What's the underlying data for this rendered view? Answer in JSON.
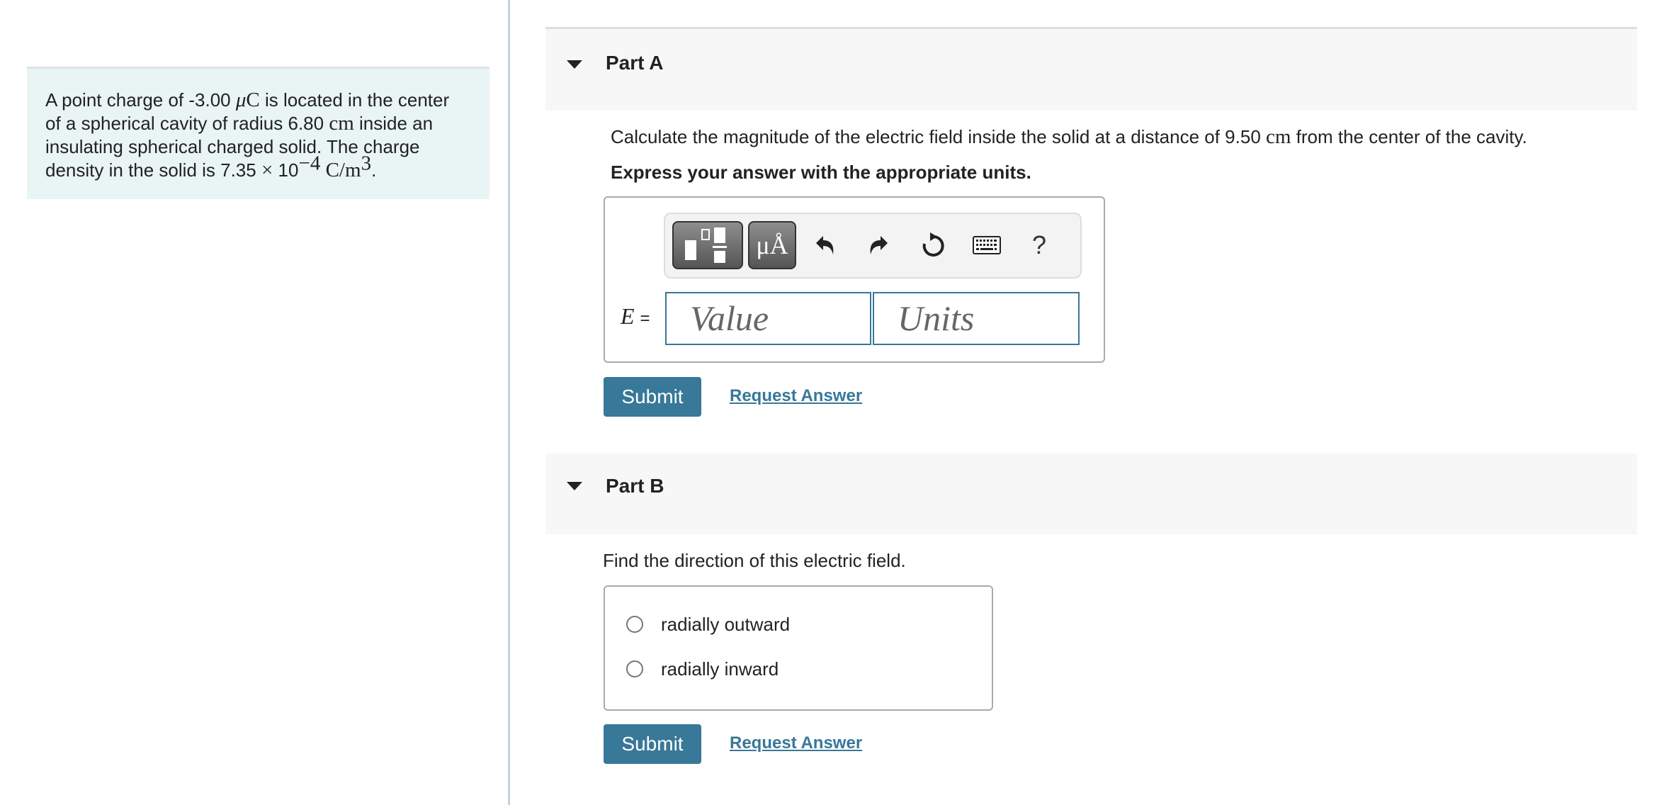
{
  "problem": {
    "text_1": "A point charge of -3.00 ",
    "unit_charge_mu": "μ",
    "unit_charge_c": "C",
    "text_2": " is located in the center",
    "text_3": "of a spherical cavity of radius 6.80 ",
    "unit_cm": "cm",
    "text_4": " inside an",
    "text_5": "insulating spherical charged solid. The charge",
    "text_6": "density in the solid is 7.35 ",
    "times": "×",
    "ten": " 10",
    "exponent": "−4",
    "unit_density": " C/m",
    "unit_density_exp": "3",
    "end": "."
  },
  "part_a": {
    "title": "Part A",
    "prompt_1": "Calculate the magnitude of the electric field inside the solid at a distance of 9.50 ",
    "prompt_unit": "cm",
    "prompt_2": " from the center of the cavity.",
    "instruction": "Express your answer with the appropriate units.",
    "toolbar": {
      "templates_icon": "templates-icon",
      "units_label": "μÅ",
      "undo_icon": "undo-icon",
      "redo_icon": "redo-icon",
      "reset_icon": "reset-icon",
      "keyboard_icon": "keyboard-icon",
      "help_label": "?"
    },
    "variable": "E",
    "equals": "=",
    "value_placeholder": "Value",
    "units_placeholder": "Units",
    "submit_label": "Submit",
    "request_label": "Request Answer"
  },
  "part_b": {
    "title": "Part B",
    "prompt": "Find the direction of this electric field.",
    "options": [
      {
        "label": "radially outward",
        "selected": false
      },
      {
        "label": "radially inward",
        "selected": false
      }
    ],
    "submit_label": "Submit",
    "request_label": "Request Answer"
  },
  "colors": {
    "accent": "#387898",
    "problem_bg": "#e9f4f5",
    "header_bg": "#f7f7f7"
  }
}
